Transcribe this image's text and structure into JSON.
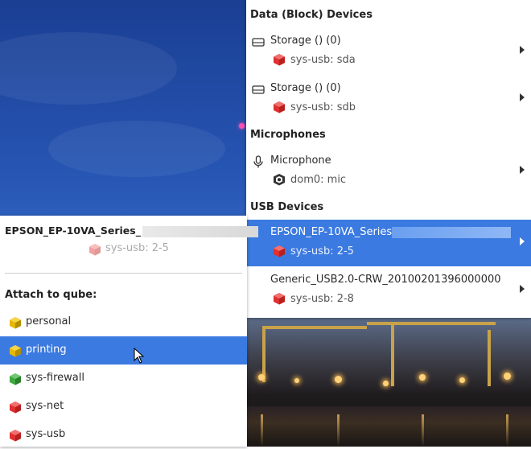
{
  "device_menu": {
    "sections": [
      {
        "header": "Data (Block) Devices",
        "items": [
          {
            "title": "Storage () (0)",
            "sub": "sys-usb: sda",
            "icon": "drive-icon",
            "qube_color": "#e03030",
            "selected": false
          },
          {
            "title": "Storage () (0)",
            "sub": "sys-usb: sdb",
            "icon": "drive-icon",
            "qube_color": "#e03030",
            "selected": false
          }
        ]
      },
      {
        "header": "Microphones",
        "items": [
          {
            "title": "Microphone",
            "sub": "dom0: mic",
            "icon": "microphone-icon",
            "qube_color": "#333333",
            "selected": false
          }
        ]
      },
      {
        "header": "USB Devices",
        "items": [
          {
            "title": "EPSON_EP-10VA_Series",
            "sub": "sys-usb: 2-5",
            "icon": "none",
            "qube_color": "#e03030",
            "selected": true
          },
          {
            "title": "Generic_USB2.0-CRW_20100201396000000",
            "sub": "sys-usb: 2-8",
            "icon": "none",
            "qube_color": "#e03030",
            "selected": false
          }
        ]
      }
    ]
  },
  "attach_menu": {
    "device_title": "EPSON_EP-10VA_Series_",
    "device_sub": "sys-usb: 2-5",
    "attach_label": "Attach to qube:",
    "qubes": [
      {
        "name": "personal",
        "color": "#e6b800",
        "selected": false
      },
      {
        "name": "printing",
        "color": "#e6b800",
        "selected": true
      },
      {
        "name": "sys-firewall",
        "color": "#3fa83f",
        "selected": false
      },
      {
        "name": "sys-net",
        "color": "#e03030",
        "selected": false
      },
      {
        "name": "sys-usb",
        "color": "#e03030",
        "selected": false
      }
    ]
  },
  "colors": {
    "selection": "#3b7ae0",
    "qube_red": "#e03030",
    "qube_yellow": "#e6b800",
    "qube_green": "#3fa83f"
  }
}
